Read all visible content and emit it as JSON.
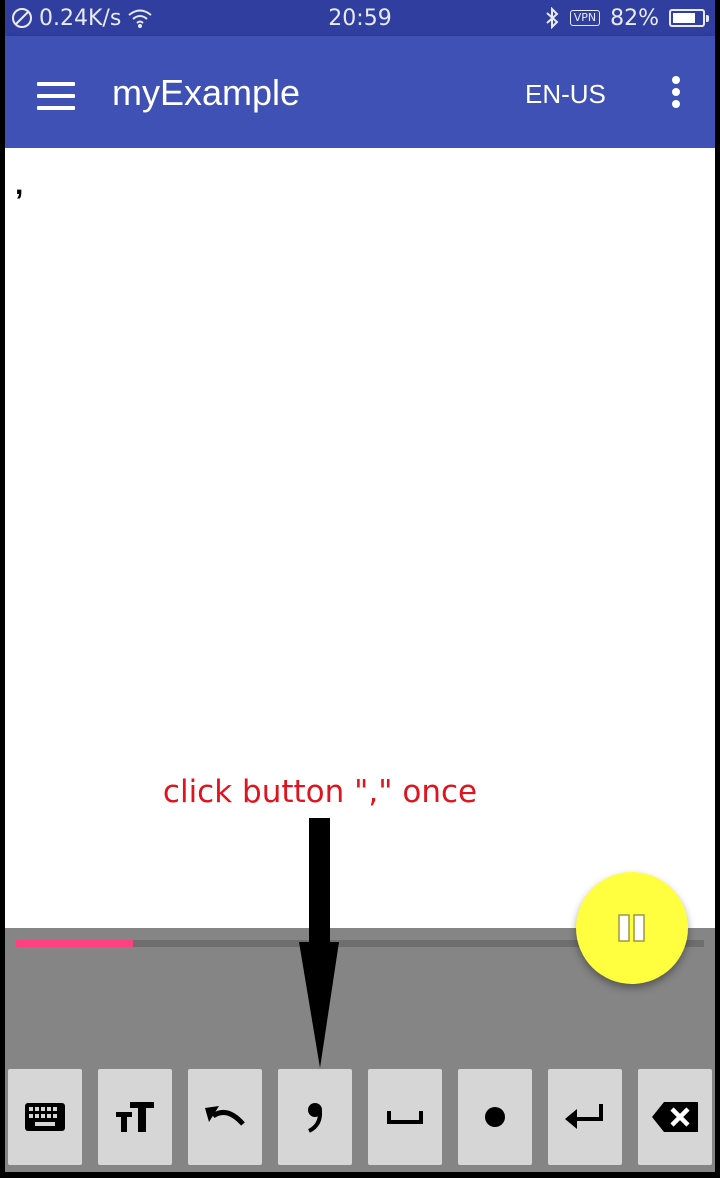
{
  "status_bar": {
    "net_speed": "0.24K/s",
    "time": "20:59",
    "vpn_label": "VPN",
    "battery_percent": "82%",
    "battery_level": 0.82,
    "icons": [
      "do-not-disturb-icon",
      "wifi-icon",
      "bluetooth-icon",
      "battery-icon"
    ]
  },
  "app_bar": {
    "title": "myExample",
    "language": "EN-US",
    "icons": [
      "menu-icon",
      "more-vert-icon"
    ],
    "color": "#3f51b5"
  },
  "editor": {
    "text": ","
  },
  "annotation": {
    "text": "click button \",\" once",
    "color": "#e0141e"
  },
  "progress": {
    "value": 0.17,
    "color": "#ff4081"
  },
  "fab": {
    "icon": "pause-icon",
    "color": "#ffff40"
  },
  "keys": [
    {
      "icon": "keyboard-icon"
    },
    {
      "icon": "text-size-icon"
    },
    {
      "icon": "undo-icon"
    },
    {
      "icon": "comma-icon"
    },
    {
      "icon": "space-icon"
    },
    {
      "icon": "period-icon"
    },
    {
      "icon": "enter-icon"
    },
    {
      "icon": "backspace-icon"
    }
  ]
}
